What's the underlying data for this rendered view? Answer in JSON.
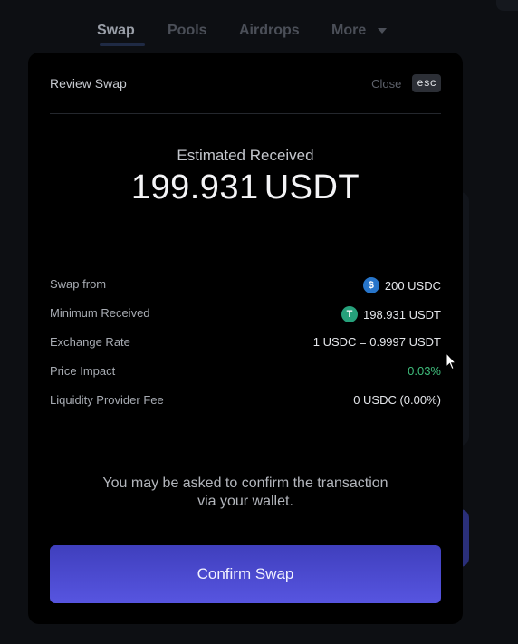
{
  "nav": {
    "items": [
      {
        "label": "Swap",
        "active": true
      },
      {
        "label": "Pools",
        "active": false
      },
      {
        "label": "Airdrops",
        "active": false
      },
      {
        "label": "More",
        "active": false
      }
    ]
  },
  "modal": {
    "title": "Review Swap",
    "close_label": "Close",
    "esc_label": "esc",
    "estimated": {
      "label": "Estimated Received",
      "amount": "199.931",
      "unit": "USDT"
    },
    "rows": [
      {
        "label": "Swap from",
        "value": "200 USDC",
        "icon": "usdc-icon"
      },
      {
        "label": "Minimum Received",
        "value": "198.931 USDT",
        "icon": "usdt-icon"
      },
      {
        "label": "Exchange Rate",
        "value": "1 USDC = 0.9997 USDT"
      },
      {
        "label": "Price Impact",
        "value": "0.03%",
        "color": "#3fbd7c"
      },
      {
        "label": "Liquidity Provider Fee",
        "value": "0 USDC (0.00%)"
      }
    ],
    "note_line1": "You may be asked to confirm the transaction",
    "note_line2": "via your wallet.",
    "confirm_label": "Confirm Swap"
  },
  "colors": {
    "accent_start": "#3f3fbd",
    "accent_end": "#5755e0",
    "positive": "#3fbd7c",
    "usdc": "#2775ca",
    "usdt": "#26a17b"
  }
}
